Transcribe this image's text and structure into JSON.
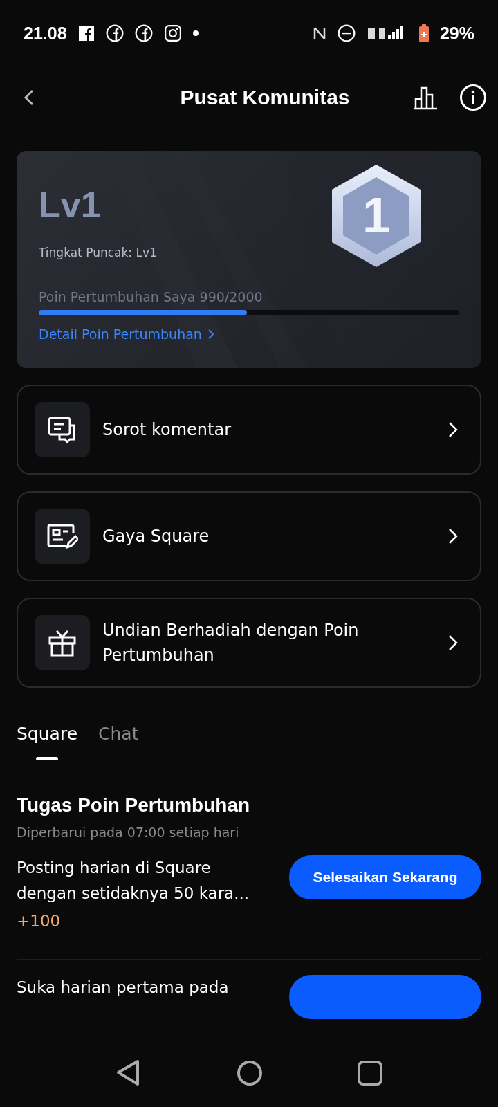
{
  "status_bar": {
    "time": "21.08",
    "battery": "29%"
  },
  "header": {
    "title": "Pusat Komunitas"
  },
  "level_card": {
    "level": "Lv1",
    "badge_number": "1",
    "peak": "Tingkat Puncak: Lv1",
    "points_label": "Poin Pertumbuhan Saya 990/2000",
    "progress": {
      "level": 0.495
    },
    "detail_link": "Detail Poin Pertumbuhan"
  },
  "menu": [
    {
      "kind": "comment",
      "label": "Sorot komentar"
    },
    {
      "kind": "style",
      "label": "Gaya Square"
    },
    {
      "kind": "gift",
      "label": "Undian Berhadiah dengan Poin Pertumbuhan"
    }
  ],
  "tabs": [
    {
      "label": "Square",
      "selected": true
    },
    {
      "label": "Chat",
      "selected": false
    }
  ],
  "tasks_section": {
    "title": "Tugas Poin Pertumbuhan",
    "subtitle": "Diperbarui pada 07:00 setiap hari",
    "tasks": [
      {
        "title": "Posting harian di Square dengan setidaknya 50 kara...",
        "reward": "+100",
        "button": "Selesaikan Sekarang"
      },
      {
        "title": "Suka harian pertama pada"
      }
    ]
  }
}
